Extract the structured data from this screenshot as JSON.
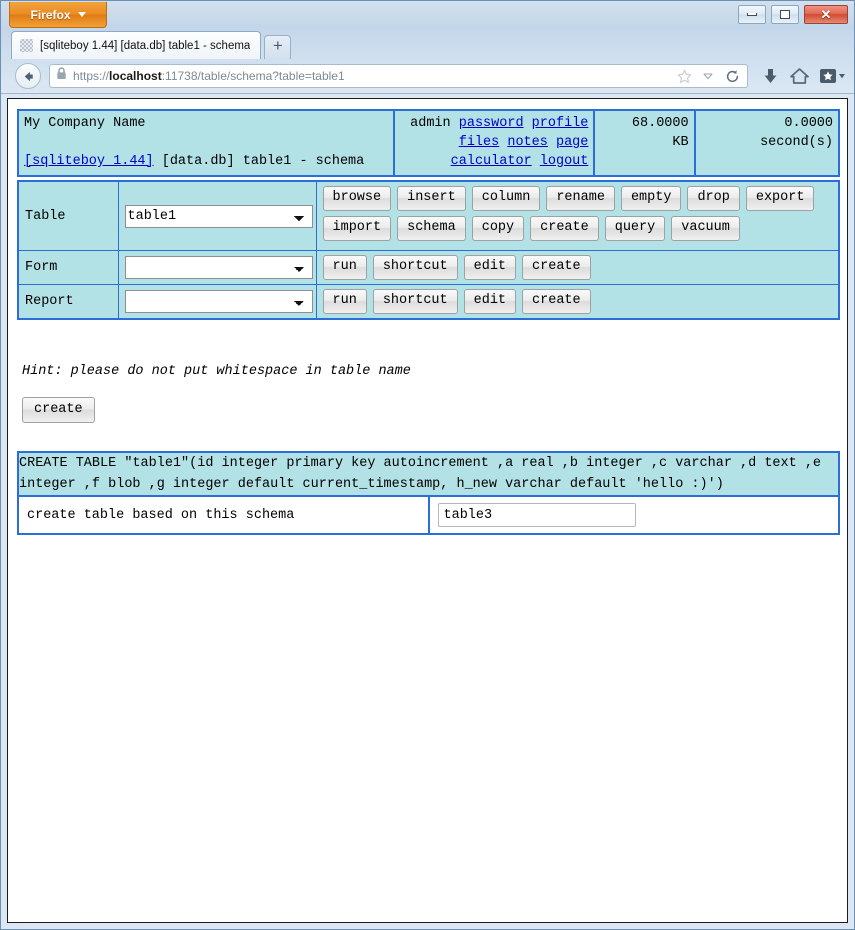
{
  "window": {
    "app_menu_label": "Firefox",
    "minimize_title": "Minimize",
    "maximize_title": "Maximize",
    "close_title": "Close",
    "close_glyph": "✕"
  },
  "tabs": {
    "active_title": "[sqliteboy 1.44] [data.db] table1 - schema",
    "new_tab_label": "+"
  },
  "navbar": {
    "url_prefix": "https://",
    "url_host": "localhost",
    "url_suffix": ":11738/table/schema?table=table1",
    "url_full": "https://localhost:11738/table/schema?table=table1"
  },
  "header": {
    "company_name": "My Company Name",
    "app_link": "[sqliteboy 1.44]",
    "app_context": " [data.db] table1 - schema",
    "account_static": "admin",
    "account_links": [
      "password",
      "profile",
      "files",
      "notes",
      "page",
      "calculator",
      "logout"
    ],
    "db_size_value": "68.0000",
    "db_size_unit": "KB",
    "time_value": "0.0000",
    "time_unit": "second(s)"
  },
  "controls": {
    "rows": [
      {
        "label": "Table",
        "select_value": "table1",
        "select_options": [
          "table1"
        ],
        "buttons": [
          "browse",
          "insert",
          "column",
          "rename",
          "empty",
          "drop",
          "export",
          "import",
          "schema",
          "copy",
          "create",
          "query",
          "vacuum"
        ]
      },
      {
        "label": "Form",
        "select_value": "",
        "select_options": [
          ""
        ],
        "buttons": [
          "run",
          "shortcut",
          "edit",
          "create"
        ]
      },
      {
        "label": "Report",
        "select_value": "",
        "select_options": [
          ""
        ],
        "buttons": [
          "run",
          "shortcut",
          "edit",
          "create"
        ]
      }
    ]
  },
  "main": {
    "hint": "Hint: please do not put whitespace in table name",
    "create_button": "create",
    "schema_sql": "CREATE TABLE \"table1\"(id integer primary key autoincrement ,a real ,b integer ,c varchar ,d text ,e integer ,f blob ,g integer default current_timestamp, h_new varchar default 'hello :)')",
    "footer_label": "create table based on this schema",
    "footer_input_value": "table3"
  },
  "colors": {
    "panel_bg": "#b2e1e6",
    "panel_border": "#2b6fd6",
    "link": "#0000cc",
    "firefox_orange": "#e8871a"
  }
}
